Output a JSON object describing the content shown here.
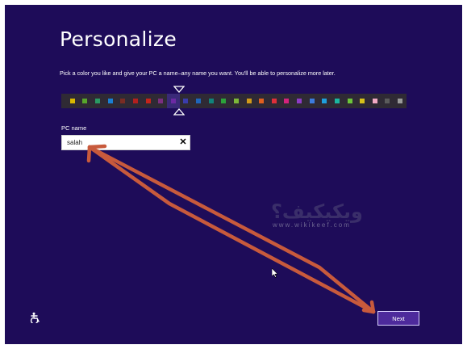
{
  "page": {
    "title": "Personalize",
    "subtitle": "Pick a color you like and give your PC a name–any name you want. You'll be able to personalize more later."
  },
  "colors": {
    "background": "#1e0c59",
    "bar": "#2f2a34",
    "accent": "#4d2a9c",
    "arrow": "#c85a3c",
    "swatches": [
      "#d8b800",
      "#58a52b",
      "#2a9a63",
      "#1a7fd3",
      "#7a2c23",
      "#b2201f",
      "#c4241b",
      "#7b2e7f",
      "#6c2aa3",
      "#3b3cab",
      "#1f66bb",
      "#11837a",
      "#2ca33a",
      "#7db839",
      "#d19a1a",
      "#e05f1f",
      "#de2f3a",
      "#d3237d",
      "#8e3bc6",
      "#3d7bde",
      "#1f9fdc",
      "#1bb7a0",
      "#6cc63a",
      "#d7c21a",
      "#f2a9c4",
      "#5b5b5b",
      "#9a9a9a"
    ]
  },
  "form": {
    "pc_name_label": "PC name",
    "pc_name_value": "salah",
    "clear_glyph": "✕"
  },
  "buttons": {
    "next_label": "Next"
  },
  "watermark": {
    "arabic": "ويكيكيف؟",
    "url": "www.wikikeef.com"
  },
  "icons": {
    "ease_of_access": "ease-of-access-icon",
    "cursor": "mouse-cursor-icon"
  }
}
